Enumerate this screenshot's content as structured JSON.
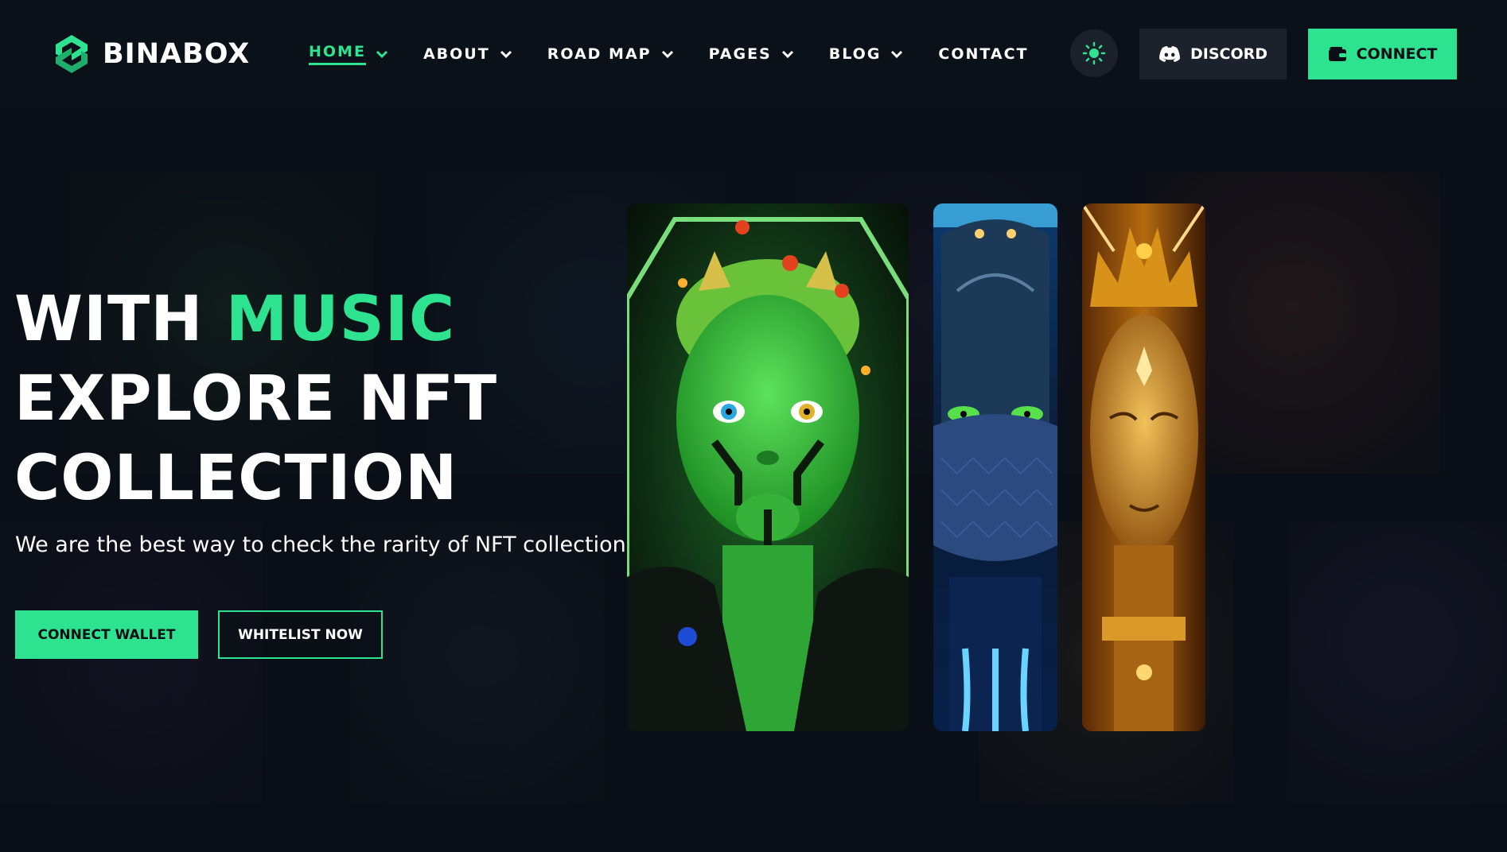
{
  "brand": {
    "name": "BINABOX",
    "accent": "#2de38f",
    "background": "#0a0f17"
  },
  "nav": {
    "items": [
      {
        "label": "HOME",
        "has_dropdown": true,
        "active": true
      },
      {
        "label": "ABOUT",
        "has_dropdown": true,
        "active": false
      },
      {
        "label": "ROAD MAP",
        "has_dropdown": true,
        "active": false
      },
      {
        "label": "PAGES",
        "has_dropdown": true,
        "active": false
      },
      {
        "label": "BLOG",
        "has_dropdown": true,
        "active": false
      },
      {
        "label": "CONTACT",
        "has_dropdown": false,
        "active": false
      }
    ]
  },
  "header_actions": {
    "theme_icon": "sun-icon",
    "discord_label": "DISCORD",
    "discord_icon": "discord-icon",
    "connect_label": "CONNECT",
    "connect_icon": "wallet-icon"
  },
  "hero": {
    "title_line1_plain": "WITH",
    "title_line1_accent": "MUSIC",
    "title_line2": "EXPLORE NFT",
    "title_line3": "COLLECTION",
    "subtitle": "We are the best way to check the rarity of NFT collection",
    "primary_button": "CONNECT WALLET",
    "secondary_button": "WHITELIST NOW"
  },
  "cards": [
    {
      "name": "green-alien-nft",
      "theme": "green"
    },
    {
      "name": "blue-masked-nft",
      "theme": "blue"
    },
    {
      "name": "gold-crowned-nft",
      "theme": "gold"
    }
  ]
}
